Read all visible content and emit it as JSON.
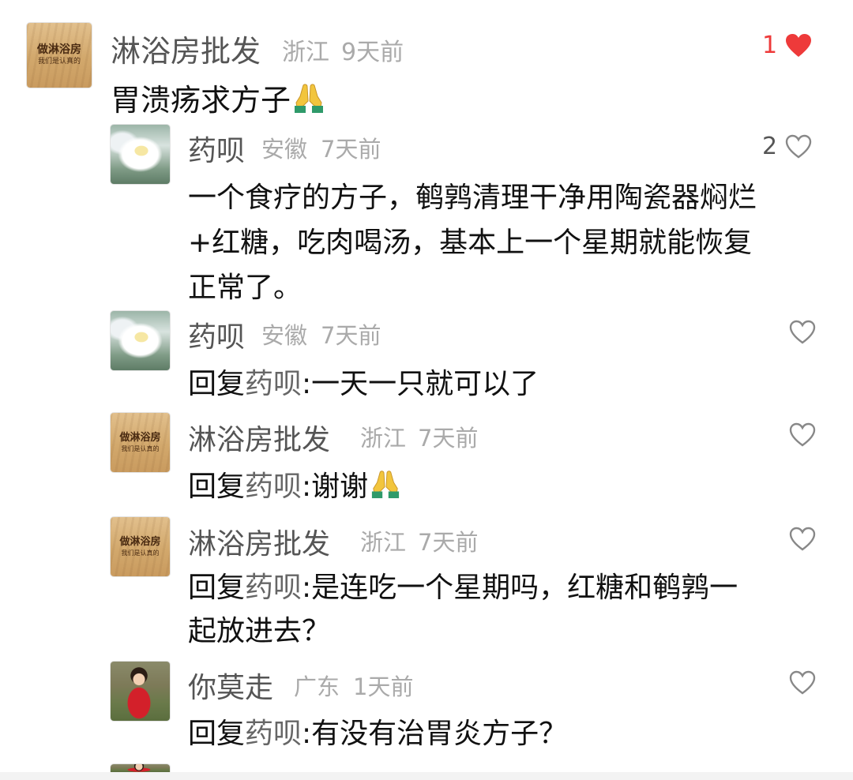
{
  "comments": [
    {
      "user": "淋浴房批发",
      "region": "浙江",
      "time": "9天前",
      "text": "胃溃疡求方子",
      "likes": "1",
      "liked": true,
      "avatar_text": [
        "做淋浴房",
        "我们是认真的"
      ],
      "emoji": "folded-hands"
    },
    {
      "user": "药呗",
      "region": "安徽",
      "time": "7天前",
      "text_lines": [
        "一个食疗的方子，鹌鹑清理干净用陶瓷器焖烂",
        "+红糖，吃肉喝汤，基本上一个星期就能恢复",
        "正常了。"
      ],
      "likes": "2",
      "liked": false
    },
    {
      "user": "药呗",
      "region": "安徽",
      "time": "7天前",
      "reply_prefix": "回复",
      "reply_to": "药呗",
      "text": ":一天一只就可以了"
    },
    {
      "user": "淋浴房批发",
      "region": "浙江",
      "time": "7天前",
      "reply_prefix": "回复",
      "reply_to": "药呗",
      "text": ":谢谢",
      "avatar_text": [
        "做淋浴房",
        "我们是认真的"
      ],
      "emoji": "folded-hands"
    },
    {
      "user": "淋浴房批发",
      "region": "浙江",
      "time": "7天前",
      "reply_prefix": "回复",
      "reply_to": "药呗",
      "text_lines": [
        ":是连吃一个星期吗，红糖和鹌鹑一",
        "起放进去？"
      ],
      "avatar_text": [
        "做淋浴房",
        "我们是认真的"
      ]
    },
    {
      "user": "你莫走",
      "region": "广东",
      "time": "1天前",
      "reply_prefix": "回复",
      "reply_to": "药呗",
      "text": ":有没有治胃炎方子？"
    }
  ],
  "colors": {
    "liked_heart": "#ee3a3a",
    "name": "#555555",
    "meta": "#aaaaaa",
    "body_text": "#111111"
  }
}
